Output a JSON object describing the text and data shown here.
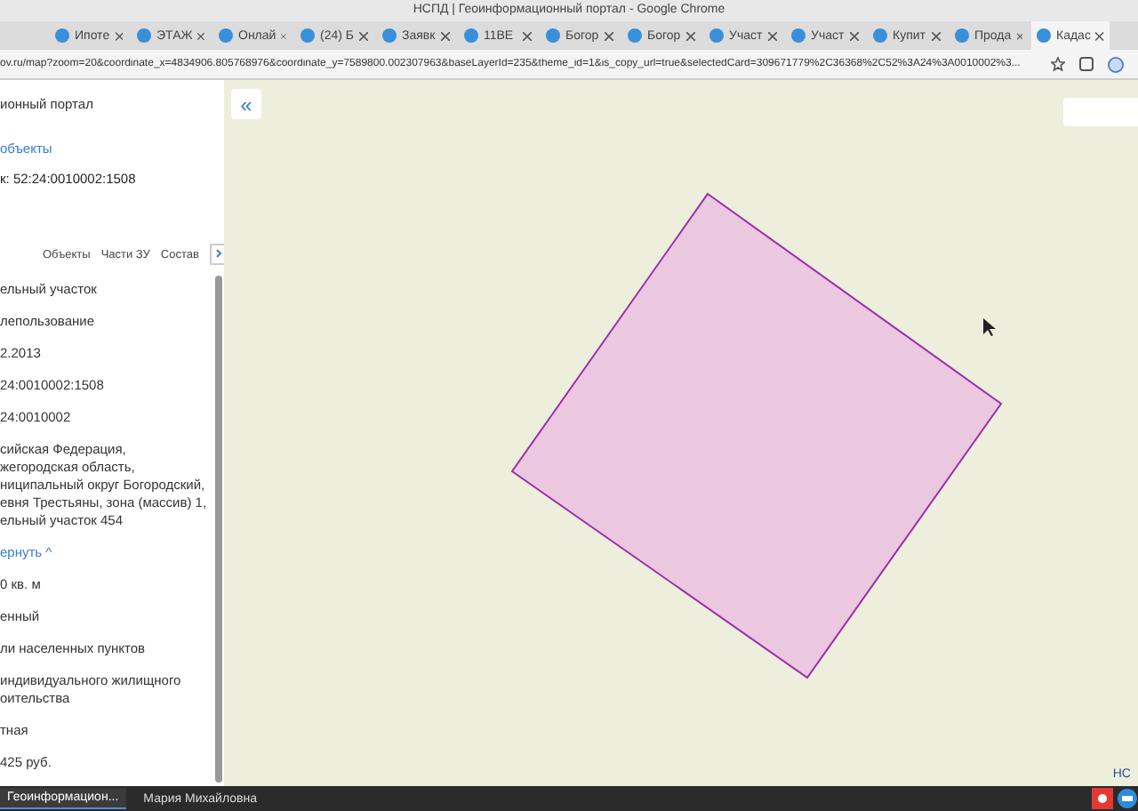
{
  "window": {
    "title": "НСПД | Геоинформационный портал - Google Chrome"
  },
  "browser_tabs": [
    {
      "label": "Ипоте",
      "selected": false
    },
    {
      "label": "ЭТАЖ",
      "selected": false
    },
    {
      "label": "Онлай",
      "selected": false
    },
    {
      "label": "(24) Б",
      "selected": false
    },
    {
      "label": "Заявк",
      "selected": false
    },
    {
      "label": "11ВЕ",
      "selected": false
    },
    {
      "label": "Богор",
      "selected": false
    },
    {
      "label": "Богор",
      "selected": false
    },
    {
      "label": "Участ",
      "selected": false
    },
    {
      "label": "Участ",
      "selected": false
    },
    {
      "label": "Купит",
      "selected": false
    },
    {
      "label": "Прода",
      "selected": false
    },
    {
      "label": "Кадас",
      "selected": true
    }
  ],
  "address": "ov.ru/map?zoom=20&coordinate_x=4834906.805768976&coordinate_y=7589800.002307963&baseLayerId=235&theme_id=1&is_copy_url=true&selectedCard=309671779%2C36368%2C52%3A24%3A0010002%3...",
  "panel": {
    "portal_title": "ионный портал",
    "back_link": "объекты",
    "heading": "к: 52:24:0010002:1508",
    "tabs": [
      {
        "label": "Объекты",
        "selected": false
      },
      {
        "label": "Части ЗУ",
        "selected": false
      },
      {
        "label": "Состав",
        "selected": false
      }
    ],
    "fields": [
      {
        "kind": "text",
        "lines": [
          "ельный участок"
        ]
      },
      {
        "kind": "text",
        "lines": [
          "лепользование"
        ]
      },
      {
        "kind": "text",
        "lines": [
          "2.2013"
        ]
      },
      {
        "kind": "text",
        "lines": [
          "24:0010002:1508"
        ]
      },
      {
        "kind": "text",
        "lines": [
          "24:0010002"
        ]
      },
      {
        "kind": "text",
        "lines": [
          "сийская Федерация,",
          "жегородская область,",
          "ниципальный округ Богородский,",
          "евня Трестьяны, зона (массив) 1,",
          "ельный участок 454"
        ]
      },
      {
        "kind": "link",
        "lines": [
          "ернуть ^"
        ]
      },
      {
        "kind": "text",
        "lines": [
          "0 кв. м"
        ]
      },
      {
        "kind": "text",
        "lines": [
          "енный"
        ]
      },
      {
        "kind": "text",
        "lines": [
          "ли населенных пунктов"
        ]
      },
      {
        "kind": "text",
        "lines": [
          "индивидуального жилищного",
          "оительства"
        ]
      },
      {
        "kind": "text",
        "lines": [
          "тная"
        ]
      },
      {
        "kind": "text",
        "lines": [
          "425 руб."
        ]
      }
    ]
  },
  "map": {
    "collapse_button": "«",
    "corner_text": "НС"
  },
  "taskbar": [
    {
      "label": "Геоинформацион...",
      "selected": true
    },
    {
      "label": "Мария Михайловна",
      "selected": false
    }
  ]
}
